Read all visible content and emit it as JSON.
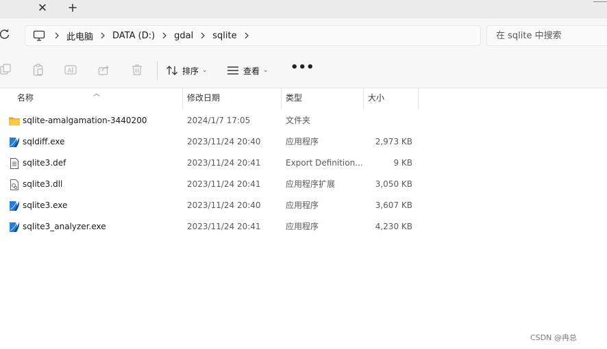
{
  "tabs": {
    "close_icon": "close-icon",
    "new_tab_icon": "plus-icon"
  },
  "address_bar": {
    "breadcrumbs": [
      {
        "label": "此电脑"
      },
      {
        "label": "DATA (D:)"
      },
      {
        "label": "gdal"
      },
      {
        "label": "sqlite"
      }
    ],
    "search_placeholder": "在 sqlite 中搜索"
  },
  "toolbar": {
    "sort_label": "排序",
    "view_label": "查看",
    "more_label": "•••"
  },
  "columns": {
    "name": "名称",
    "date": "修改日期",
    "type": "类型",
    "size": "大小"
  },
  "files": [
    {
      "name": "sqlite-amalgamation-3440200",
      "date": "2024/1/7 17:05",
      "type": "文件夹",
      "size": "",
      "icon": "folder-icon"
    },
    {
      "name": "sqldiff.exe",
      "date": "2023/11/24 20:40",
      "type": "应用程序",
      "size": "2,973 KB",
      "icon": "exe-icon"
    },
    {
      "name": "sqlite3.def",
      "date": "2023/11/24 20:41",
      "type": "Export Definition...",
      "size": "9 KB",
      "icon": "document-icon"
    },
    {
      "name": "sqlite3.dll",
      "date": "2023/11/24 20:41",
      "type": "应用程序扩展",
      "size": "3,050 KB",
      "icon": "dll-icon"
    },
    {
      "name": "sqlite3.exe",
      "date": "2023/11/24 20:40",
      "type": "应用程序",
      "size": "3,607 KB",
      "icon": "exe-icon"
    },
    {
      "name": "sqlite3_analyzer.exe",
      "date": "2023/11/24 20:41",
      "type": "应用程序",
      "size": "4,230 KB",
      "icon": "exe-icon"
    }
  ],
  "watermark": "CSDN @冉总",
  "colors": {
    "folder": "#f5c242",
    "exe_blue": "#1f6fc4",
    "accent_line": "#e5e5e5"
  }
}
